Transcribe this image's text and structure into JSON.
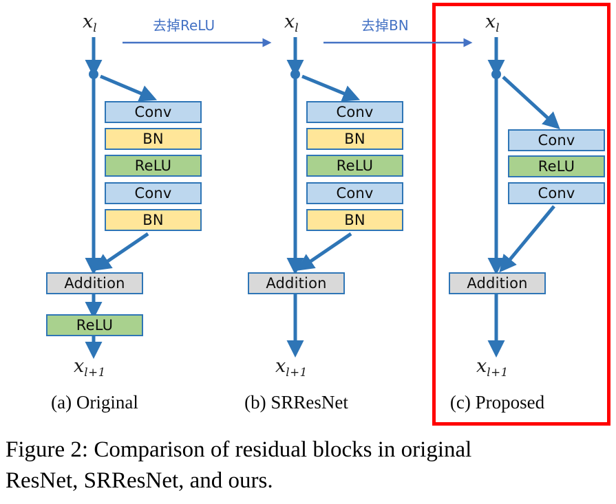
{
  "figure": {
    "caption_line1": "Figure 2: Comparison of residual blocks in original",
    "caption_line2": "ResNet, SRResNet, and ours.",
    "highlight_color": "#ff0000",
    "arrow_color": "#2e75b6",
    "transition_label_color": "#4472c4"
  },
  "transitions": [
    {
      "label": "去掉ReLU",
      "from": "a",
      "to": "b"
    },
    {
      "label": "去掉BN",
      "from": "b",
      "to": "c"
    }
  ],
  "columns": [
    {
      "id": "a",
      "caption": "(a) Original",
      "input_label": "x",
      "input_sub": "l",
      "output_label": "x",
      "output_sub": "l+1",
      "highlighted": false,
      "branch_blocks": [
        {
          "label": "Conv",
          "kind": "conv",
          "color": "#bdd7ee"
        },
        {
          "label": "BN",
          "kind": "bn",
          "color": "#ffe699"
        },
        {
          "label": "ReLU",
          "kind": "relu",
          "color": "#a9d18e"
        },
        {
          "label": "Conv",
          "kind": "conv",
          "color": "#bdd7ee"
        },
        {
          "label": "BN",
          "kind": "bn",
          "color": "#ffe699"
        }
      ],
      "merge_block": {
        "label": "Addition",
        "kind": "add",
        "color": "#d9d9d9"
      },
      "post_blocks": [
        {
          "label": "ReLU",
          "kind": "relu",
          "color": "#a9d18e"
        }
      ]
    },
    {
      "id": "b",
      "caption": "(b) SRResNet",
      "input_label": "x",
      "input_sub": "l",
      "output_label": "x",
      "output_sub": "l+1",
      "highlighted": false,
      "branch_blocks": [
        {
          "label": "Conv",
          "kind": "conv",
          "color": "#bdd7ee"
        },
        {
          "label": "BN",
          "kind": "bn",
          "color": "#ffe699"
        },
        {
          "label": "ReLU",
          "kind": "relu",
          "color": "#a9d18e"
        },
        {
          "label": "Conv",
          "kind": "conv",
          "color": "#bdd7ee"
        },
        {
          "label": "BN",
          "kind": "bn",
          "color": "#ffe699"
        }
      ],
      "merge_block": {
        "label": "Addition",
        "kind": "add",
        "color": "#d9d9d9"
      },
      "post_blocks": []
    },
    {
      "id": "c",
      "caption": "(c) Proposed",
      "input_label": "x",
      "input_sub": "l",
      "output_label": "x",
      "output_sub": "l+1",
      "highlighted": true,
      "branch_blocks": [
        {
          "label": "Conv",
          "kind": "conv",
          "color": "#bdd7ee"
        },
        {
          "label": "ReLU",
          "kind": "relu",
          "color": "#a9d18e"
        },
        {
          "label": "Conv",
          "kind": "conv",
          "color": "#bdd7ee"
        }
      ],
      "merge_block": {
        "label": "Addition",
        "kind": "add",
        "color": "#d9d9d9"
      },
      "post_blocks": []
    }
  ]
}
